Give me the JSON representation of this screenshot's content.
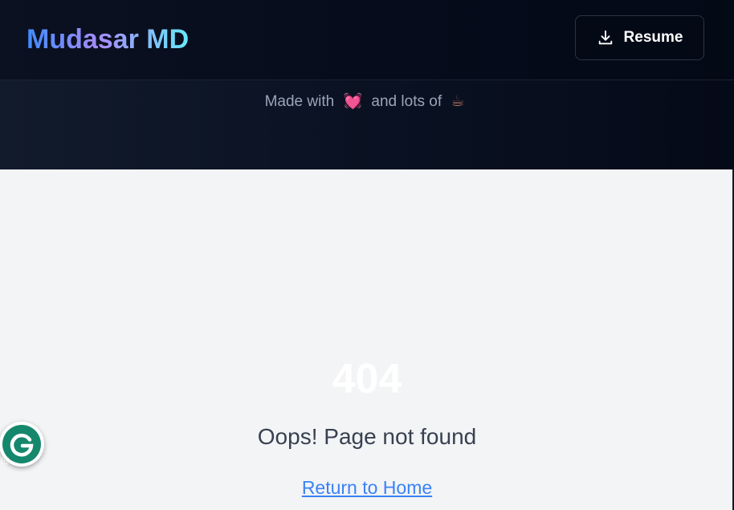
{
  "header": {
    "brand": "Mudasar MD",
    "resume_label": "Resume",
    "resume_icon": "download-icon"
  },
  "footer": {
    "made_with_text": "Made with",
    "heart_emoji": "💓",
    "and_lots_of_text": "and lots of",
    "coffee_emoji": "☕"
  },
  "error": {
    "code": "404",
    "message": "Oops! Page not found",
    "return_link": "Return to Home"
  },
  "widgets": {
    "grammarly_icon": "grammarly-icon"
  },
  "colors": {
    "header_bg": "#060c1c",
    "page_bg": "#f3f4f6",
    "link": "#3b82f6",
    "grammarly": "#15876c"
  }
}
